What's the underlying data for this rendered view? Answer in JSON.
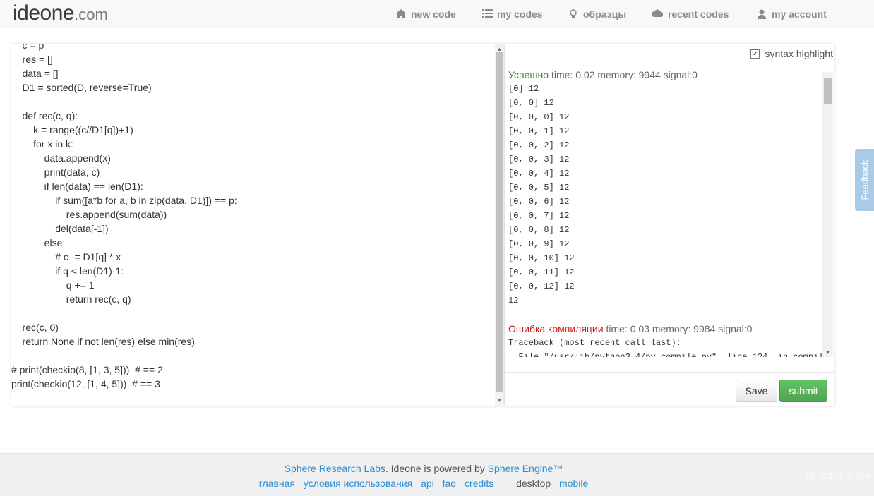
{
  "header": {
    "logo_main": "ideone",
    "logo_suffix": ".com",
    "nav": [
      {
        "label": "new code",
        "icon": "home-icon"
      },
      {
        "label": "my codes",
        "icon": "list-icon"
      },
      {
        "label": "образцы",
        "icon": "lightbulb-icon"
      },
      {
        "label": "recent codes",
        "icon": "cloud-icon"
      },
      {
        "label": "my account",
        "icon": "user-icon"
      }
    ]
  },
  "editor": {
    "lines": [
      "    c = p",
      "    res = []",
      "    data = []",
      "    D1 = sorted(D, reverse=True)",
      "",
      "    def rec(c, q):",
      "        k = range((c//D1[q])+1)",
      "        for x in k:",
      "            data.append(x)",
      "            print(data, c)",
      "            if len(data) == len(D1):",
      "                if sum([a*b for a, b in zip(data, D1)]) == p:",
      "                    res.append(sum(data))",
      "                del(data[-1])",
      "            else:",
      "                # c -= D1[q] * x",
      "                if q < len(D1)-1:",
      "                    q += 1",
      "                    return rec(c, q)",
      "",
      "    rec(c, 0)",
      "    return None if not len(res) else min(res)",
      "",
      "# print(checkio(8, [1, 3, 5]))  # == 2",
      "print(checkio(12, [1, 4, 5]))  # == 3"
    ]
  },
  "output": {
    "syntax_label": "syntax highlight",
    "syntax_checked": true,
    "run1": {
      "status": "Успешно",
      "stats": " time: 0.02 memory: 9944 signal:0",
      "lines": [
        "[0] 12",
        "[0, 0] 12",
        "[0, 0, 0] 12",
        "[0, 0, 1] 12",
        "[0, 0, 2] 12",
        "[0, 0, 3] 12",
        "[0, 0, 4] 12",
        "[0, 0, 5] 12",
        "[0, 0, 6] 12",
        "[0, 0, 7] 12",
        "[0, 0, 8] 12",
        "[0, 0, 9] 12",
        "[0, 0, 10] 12",
        "[0, 0, 11] 12",
        "[0, 0, 12] 12",
        "12"
      ]
    },
    "run2": {
      "status": "Ошибка компиляции",
      "stats": " time: 0.03 memory: 9984 signal:0",
      "lines": [
        "Traceback (most recent call last):",
        "  File \"/usr/lib/python3.4/py_compile.py\", line 124, in compil"
      ]
    },
    "save_label": "Save",
    "submit_label": "submit"
  },
  "feedback_label": "Feedback",
  "footer": {
    "company": "Sphere Research Labs",
    "powered_text": ". Ideone is powered by ",
    "engine": "Sphere Engine™",
    "links": [
      "главная",
      "условия использования",
      "api",
      "faq",
      "credits"
    ],
    "desktop": "desktop",
    "mobile": "mobile",
    "timing": "18, 0.20s, 0.25s"
  },
  "colors": {
    "success": "#2e8b22",
    "error": "#d31a1a",
    "link": "#2a8fd4",
    "submit": "#5bb75b",
    "feedback_tab": "#a9cbe8"
  }
}
